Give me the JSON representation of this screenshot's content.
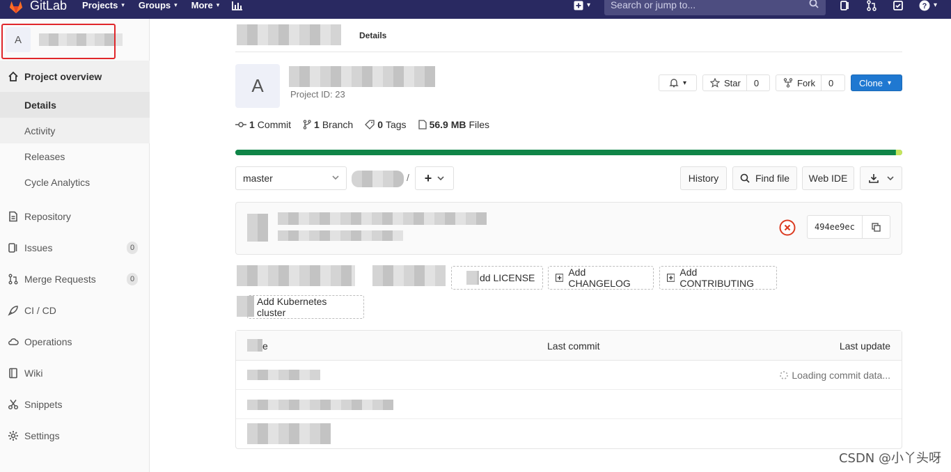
{
  "navbar": {
    "brand": "GitLab",
    "menu": [
      {
        "label": "Projects",
        "caret": "▾"
      },
      {
        "label": "Groups",
        "caret": "▾"
      },
      {
        "label": "More",
        "caret": "▾"
      }
    ],
    "search_placeholder": "Search or jump to...",
    "plus_caret": "▾",
    "help_caret": "▾"
  },
  "sidebar": {
    "context_initial": "A",
    "items": [
      {
        "label": "Project overview",
        "icon": "home-icon"
      },
      {
        "label": "Repository",
        "icon": "document-icon"
      },
      {
        "label": "Issues",
        "icon": "issues-icon",
        "count": "0"
      },
      {
        "label": "Merge Requests",
        "icon": "merge-request-icon",
        "count": "0"
      },
      {
        "label": "CI / CD",
        "icon": "rocket-icon"
      },
      {
        "label": "Operations",
        "icon": "cloud-icon"
      },
      {
        "label": "Wiki",
        "icon": "book-icon"
      },
      {
        "label": "Snippets",
        "icon": "scissors-icon"
      },
      {
        "label": "Settings",
        "icon": "gear-icon"
      }
    ],
    "subitems": [
      "Details",
      "Activity",
      "Releases",
      "Cycle Analytics"
    ]
  },
  "breadcrumb": {
    "current": "Details"
  },
  "project": {
    "initial": "A",
    "id_text": "Project ID: 23",
    "star_label": "Star",
    "star_count": "0",
    "fork_label": "Fork",
    "fork_count": "0",
    "clone_label": "Clone",
    "notification_caret": "▾"
  },
  "stats": {
    "commits_count": "1",
    "commits_label": "Commit",
    "branches_count": "1",
    "branches_label": "Branch",
    "tags_count": "0",
    "tags_label": "Tags",
    "files_size": "56.9 MB",
    "files_label": "Files"
  },
  "repo_bar": {
    "primary_fraction": 0.99,
    "colors": {
      "primary": "#108548",
      "secondary": "#c7e45d"
    }
  },
  "toolbar": {
    "branch": "master",
    "path_separator": "/",
    "history": "History",
    "find_file": "Find file",
    "web_ide": "Web IDE"
  },
  "commit": {
    "sha": "494ee9ec",
    "status_color": "#db3b21"
  },
  "suggestions": {
    "add_license": "Add LICENSE",
    "add_license_visible": "dd LICENSE",
    "add_changelog": "Add CHANGELOG",
    "add_contributing": "Add CONTRIBUTING",
    "add_kubernetes": "Add Kubernetes cluster"
  },
  "files_table": {
    "col_name_visible": "e",
    "col_last_commit": "Last commit",
    "col_last_update": "Last update",
    "loading_text": "Loading commit data..."
  },
  "watermark": "CSDN @小丫头呀"
}
